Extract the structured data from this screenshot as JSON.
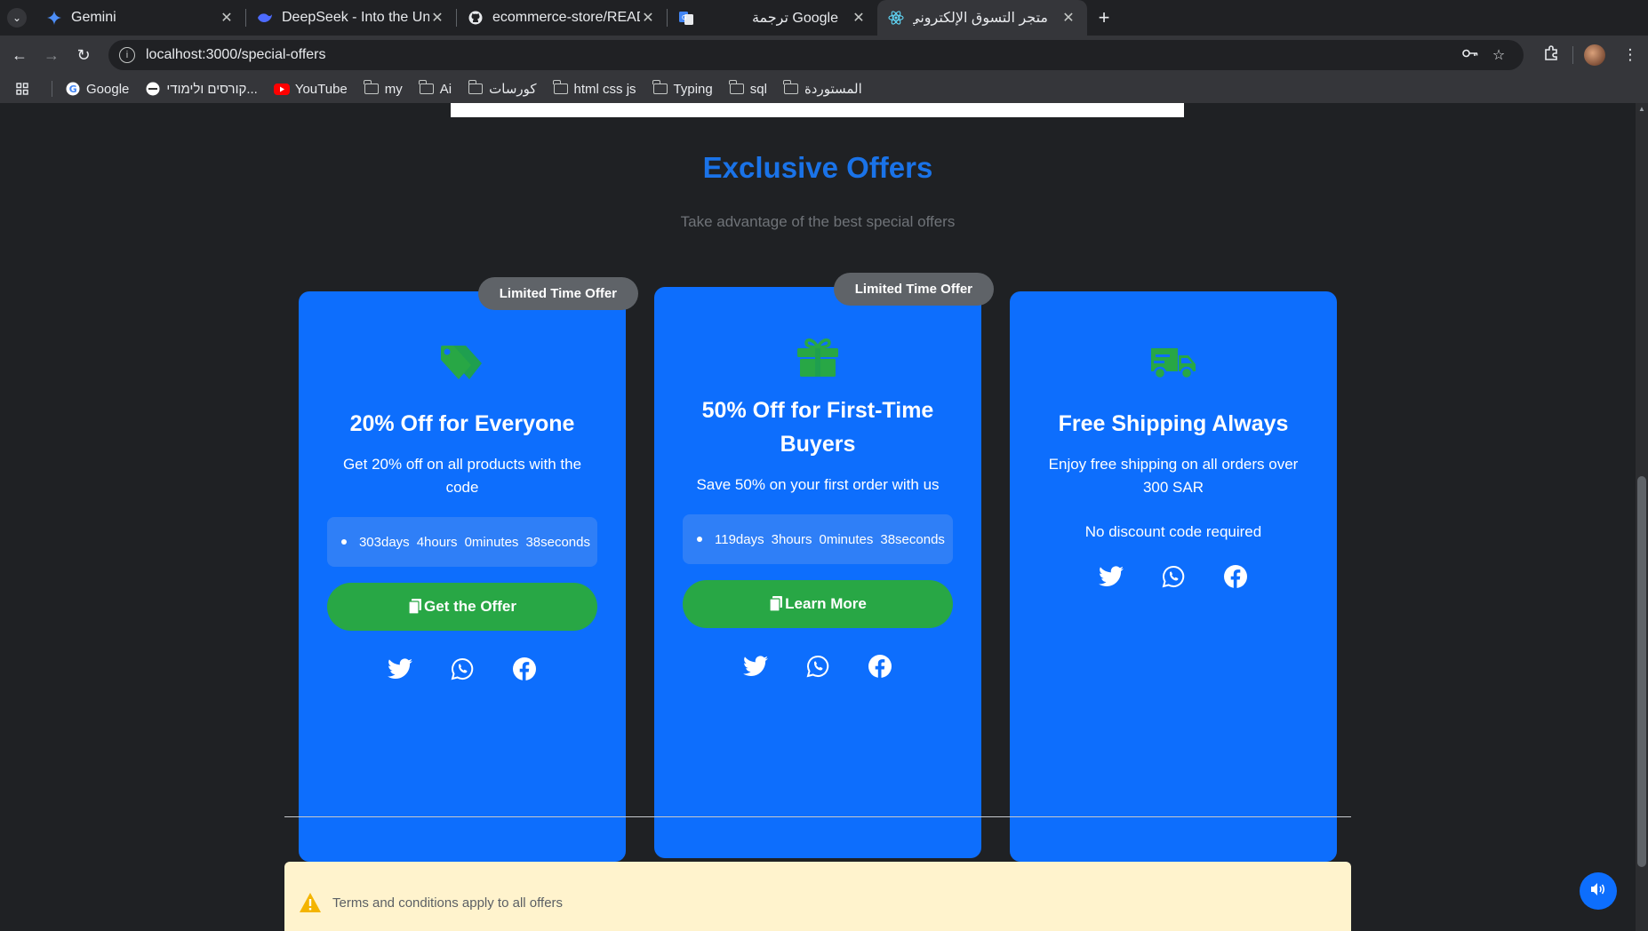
{
  "browser": {
    "tabs": [
      {
        "label": "Gemini",
        "icon": "gemini-icon",
        "active": false
      },
      {
        "label": "DeepSeek - Into the Unkno",
        "icon": "deepseek-icon",
        "active": false
      },
      {
        "label": "ecommerce-store/READM",
        "icon": "github-icon",
        "active": false
      },
      {
        "label": "Google ترجمة",
        "icon": "translate-icon",
        "active": false
      },
      {
        "label": "متجر التسوق الإلكتروني",
        "icon": "react-icon",
        "active": true
      }
    ],
    "url": "localhost:3000/special-offers",
    "bookmarks": [
      {
        "label": "Google",
        "icon": "google-icon"
      },
      {
        "label": "קורסים ולימודי...",
        "icon": "site-icon"
      },
      {
        "label": "YouTube",
        "icon": "youtube-icon"
      },
      {
        "label": "my",
        "icon": "folder-icon"
      },
      {
        "label": "Ai",
        "icon": "folder-icon"
      },
      {
        "label": "كورسات",
        "icon": "folder-icon"
      },
      {
        "label": "html css js",
        "icon": "folder-icon"
      },
      {
        "label": "Typing",
        "icon": "folder-icon"
      },
      {
        "label": "sql",
        "icon": "folder-icon"
      },
      {
        "label": "المستوردة",
        "icon": "folder-icon"
      }
    ]
  },
  "page": {
    "title": "Exclusive Offers",
    "subtitle": "Take advantage of the best special offers",
    "offers": [
      {
        "badge": "Limited Time Offer",
        "icon": "tag-icon",
        "title": "20% Off for Everyone",
        "description": "Get 20% off on all products with the code",
        "countdown": {
          "days": "303days",
          "hours": "4hours",
          "minutes": "0minutes",
          "seconds": "38seconds"
        },
        "button": "Get the Offer"
      },
      {
        "badge": "Limited Time Offer",
        "icon": "gift-icon",
        "title": "50% Off for First-Time Buyers",
        "description": "Save 50% on your first order with us",
        "countdown": {
          "days": "119days",
          "hours": "3hours",
          "minutes": "0minutes",
          "seconds": "38seconds"
        },
        "button": "Learn More"
      },
      {
        "icon": "truck-icon",
        "title": "Free Shipping Always",
        "description": "Enjoy free shipping on all orders over 300 SAR",
        "note": "No discount code required"
      }
    ],
    "terms": "Terms and conditions apply to all offers"
  },
  "colors": {
    "accent": "#1a73e8",
    "card": "#0d6efd",
    "button": "#28a745",
    "icon": "#28a745",
    "badge": "#5f6368",
    "terms_bg": "#fff3cd"
  }
}
